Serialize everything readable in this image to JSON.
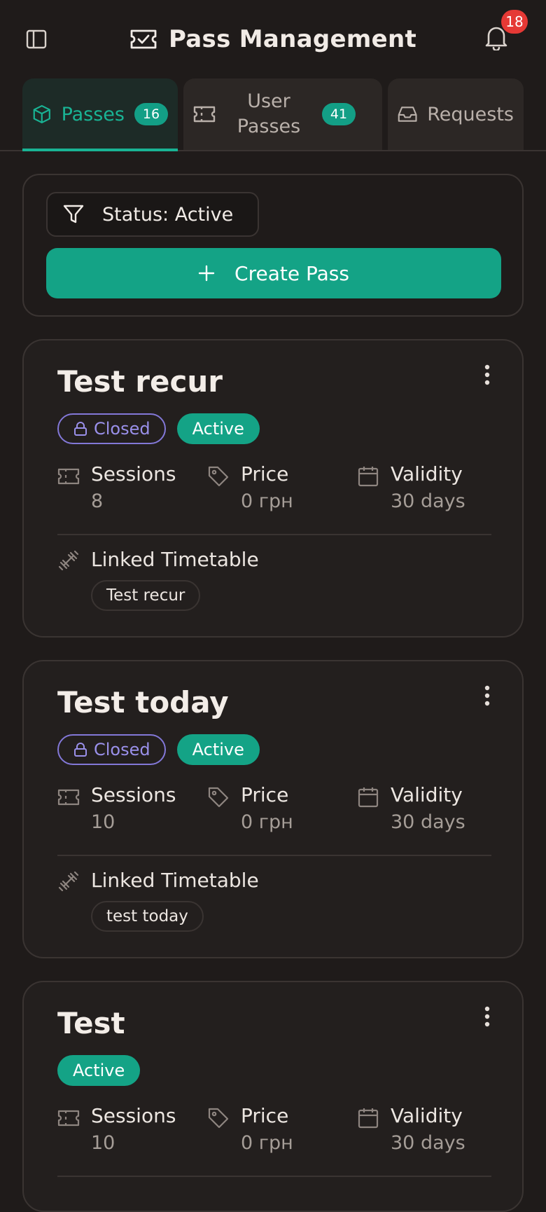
{
  "header": {
    "title": "Pass Management",
    "notification_count": "18"
  },
  "tabs": [
    {
      "label": "Passes",
      "count": "16",
      "icon": "cube-icon",
      "active": true
    },
    {
      "label": "User Passes",
      "label_line1": "User",
      "label_line2": "Passes",
      "count": "41",
      "icon": "ticket-icon",
      "active": false
    },
    {
      "label": "Requests",
      "icon": "inbox-icon",
      "active": false
    }
  ],
  "filter": {
    "status_label": "Status: Active",
    "create_label": "Create Pass"
  },
  "passes": [
    {
      "title": "Test recur",
      "closed_label": "Closed",
      "status_label": "Active",
      "sessions_label": "Sessions",
      "sessions_value": "8",
      "price_label": "Price",
      "price_value": "0 грн",
      "validity_label": "Validity",
      "validity_value": "30 days",
      "linked_label": "Linked Timetable",
      "timetable": "Test recur"
    },
    {
      "title": "Test today",
      "closed_label": "Closed",
      "status_label": "Active",
      "sessions_label": "Sessions",
      "sessions_value": "10",
      "price_label": "Price",
      "price_value": "0 грн",
      "validity_label": "Validity",
      "validity_value": "30 days",
      "linked_label": "Linked Timetable",
      "timetable": "test today"
    },
    {
      "title": "Test",
      "status_label": "Active",
      "sessions_label": "Sessions",
      "sessions_value": "10",
      "price_label": "Price",
      "price_value": "0 грн",
      "validity_label": "Validity",
      "validity_value": "30 days"
    }
  ],
  "colors": {
    "background": "#1f1b1a",
    "accent": "#14a386",
    "closed": "#8378d8",
    "badge_red": "#e53935"
  }
}
